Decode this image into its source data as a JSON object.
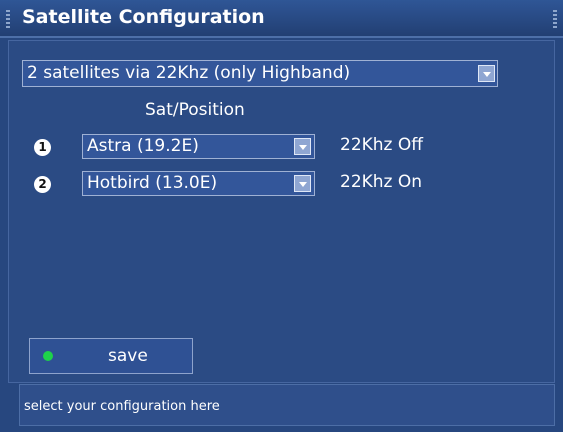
{
  "window": {
    "title": "Satellite Configuration"
  },
  "config": {
    "selected": "2 satellites via 22Khz (only Highband)"
  },
  "table": {
    "header": "Sat/Position",
    "rows": [
      {
        "num": "1",
        "satellite": "Astra (19.2E)",
        "tone": "22Khz Off"
      },
      {
        "num": "2",
        "satellite": "Hotbird (13.0E)",
        "tone": "22Khz On"
      }
    ]
  },
  "save": {
    "label": "save",
    "indicator_color": "#1ed24a"
  },
  "status": {
    "text": "select your configuration here"
  },
  "colors": {
    "background": "#27477f",
    "panel": "#2b4b84",
    "text": "#ffffff"
  }
}
